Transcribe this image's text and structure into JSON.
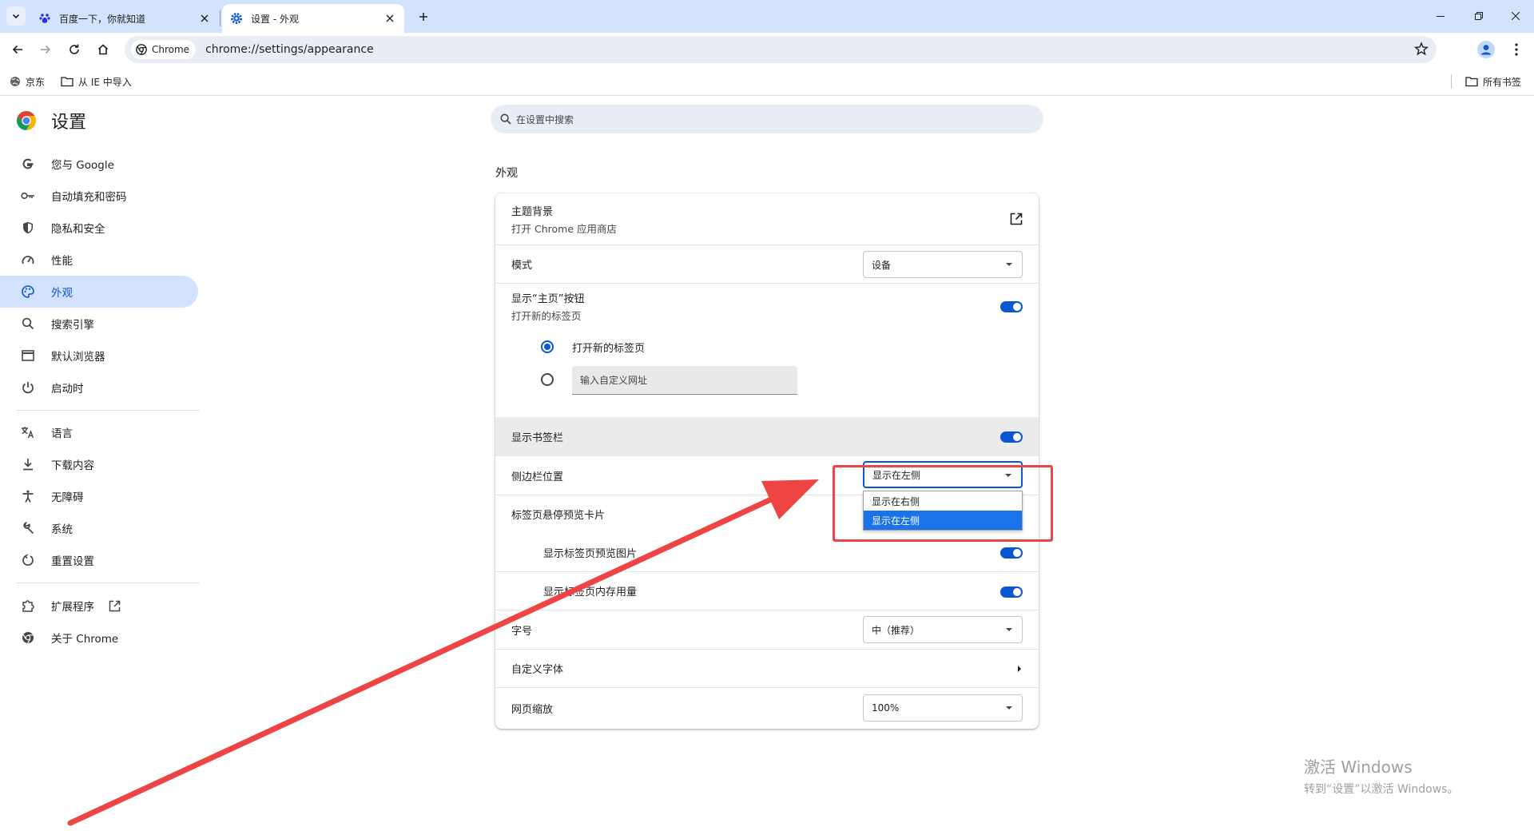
{
  "tabs": [
    {
      "title": "百度一下，你就知道",
      "active": false
    },
    {
      "title": "设置 - 外观",
      "active": true
    }
  ],
  "toolbar": {
    "chip_label": "Chrome",
    "url": "chrome://settings/appearance"
  },
  "bookmarks": {
    "items": [
      "京东",
      "从 IE 中导入"
    ],
    "all_bookmarks": "所有书签"
  },
  "sidebar": {
    "title": "设置",
    "items": [
      {
        "label": "您与 Google",
        "icon": "google-g-icon"
      },
      {
        "label": "自动填充和密码",
        "icon": "key-icon"
      },
      {
        "label": "隐私和安全",
        "icon": "shield-icon"
      },
      {
        "label": "性能",
        "icon": "speedometer-icon"
      },
      {
        "label": "外观",
        "icon": "palette-icon",
        "selected": true
      },
      {
        "label": "搜索引擎",
        "icon": "search-icon"
      },
      {
        "label": "默认浏览器",
        "icon": "browser-window-icon"
      },
      {
        "label": "启动时",
        "icon": "power-icon"
      },
      {
        "label": "语言",
        "icon": "translate-icon"
      },
      {
        "label": "下载内容",
        "icon": "download-icon"
      },
      {
        "label": "无障碍",
        "icon": "accessibility-icon"
      },
      {
        "label": "系统",
        "icon": "wrench-icon"
      },
      {
        "label": "重置设置",
        "icon": "reset-icon"
      },
      {
        "label": "扩展程序",
        "icon": "extension-icon"
      },
      {
        "label": "关于 Chrome",
        "icon": "chrome-icon"
      }
    ]
  },
  "search": {
    "placeholder": "在设置中搜索"
  },
  "section_title": "外观",
  "appearance": {
    "theme": {
      "label": "主题背景",
      "sub": "打开 Chrome 应用商店"
    },
    "mode": {
      "label": "模式",
      "value": "设备"
    },
    "home_button": {
      "label": "显示“主页”按钮",
      "sub": "打开新的标签页",
      "on": true
    },
    "home_options": {
      "new_tab": "打开新的标签页",
      "custom_placeholder": "输入自定义网址"
    },
    "bookmarks_bar": {
      "label": "显示书签栏",
      "on": true
    },
    "side_panel": {
      "label": "侧边栏位置",
      "value": "显示在左侧",
      "options": [
        "显示在右侧",
        "显示在左侧"
      ],
      "selected_option": "显示在左侧"
    },
    "tab_hover": {
      "label": "标签页悬停预览卡片"
    },
    "tab_preview_image": {
      "label": "显示标签页预览图片",
      "on": true
    },
    "tab_memory": {
      "label": "显示标签页内存用量",
      "on": true
    },
    "font_size": {
      "label": "字号",
      "value": "中（推荐）"
    },
    "custom_fonts": {
      "label": "自定义字体"
    },
    "page_zoom": {
      "label": "网页缩放",
      "value": "100%"
    }
  },
  "watermark": {
    "line1": "激活 Windows",
    "line2": "转到“设置”以激活 Windows。"
  },
  "colors": {
    "accent": "#0b57d0",
    "annotation": "#ef4444",
    "titlebar": "#d3e3fd"
  }
}
